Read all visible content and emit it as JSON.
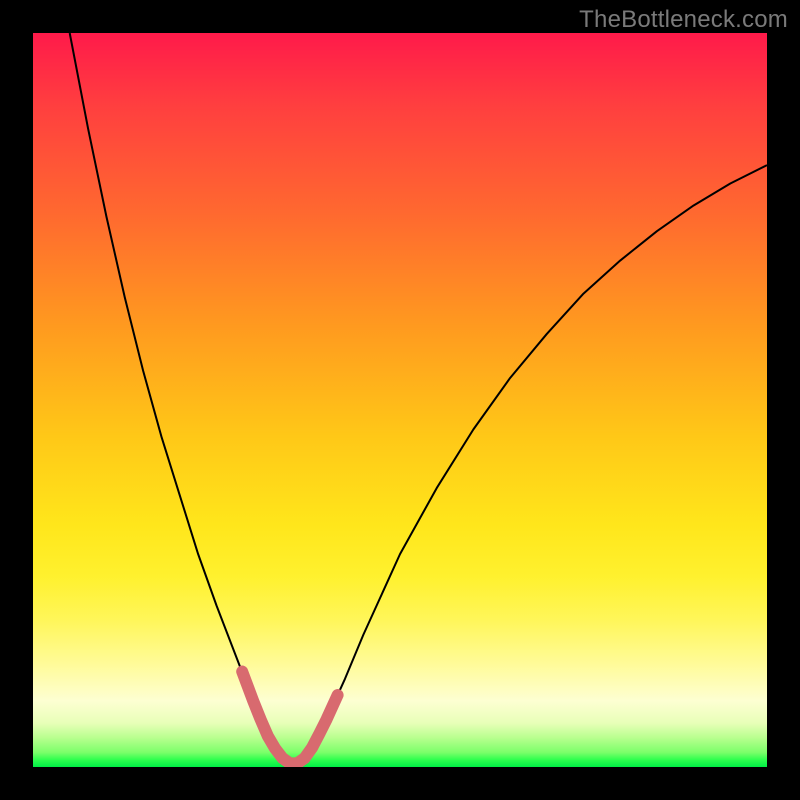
{
  "watermark": "TheBottleneck.com",
  "chart_data": {
    "type": "line",
    "title": "",
    "xlabel": "",
    "ylabel": "",
    "xlim": [
      0,
      100
    ],
    "ylim": [
      0,
      100
    ],
    "grid": false,
    "legend": false,
    "background_gradient": [
      "#ff1a4a",
      "#ff9a1f",
      "#ffe61b",
      "#fffb99",
      "#00ee46"
    ],
    "series": [
      {
        "name": "bottleneck-curve",
        "color": "#000000",
        "stroke_width": 2,
        "x": [
          5,
          7.5,
          10,
          12.5,
          15,
          17.5,
          20,
          22.5,
          25,
          27.5,
          30,
          31,
          32,
          33,
          34,
          35,
          36,
          37,
          38,
          40,
          42.5,
          45,
          50,
          55,
          60,
          65,
          70,
          75,
          80,
          85,
          90,
          95,
          100
        ],
        "values": [
          100,
          87,
          75,
          64,
          54,
          45,
          37,
          29,
          22,
          15.5,
          9,
          6.5,
          4.2,
          2.5,
          1.2,
          0.5,
          0.5,
          1.2,
          2.6,
          6.5,
          12,
          18,
          29,
          38,
          46,
          53,
          59,
          64.5,
          69,
          73,
          76.5,
          79.5,
          82
        ]
      },
      {
        "name": "optimal-band-marker",
        "color": "#d86a6f",
        "stroke_width": 12,
        "linecap": "round",
        "x": [
          28.5,
          30,
          31,
          32,
          33,
          34,
          35,
          36,
          37,
          38,
          39,
          40,
          41.5
        ],
        "values": [
          13,
          9,
          6.5,
          4.2,
          2.5,
          1.2,
          0.5,
          0.5,
          1.2,
          2.6,
          4.5,
          6.5,
          9.8
        ]
      }
    ]
  }
}
